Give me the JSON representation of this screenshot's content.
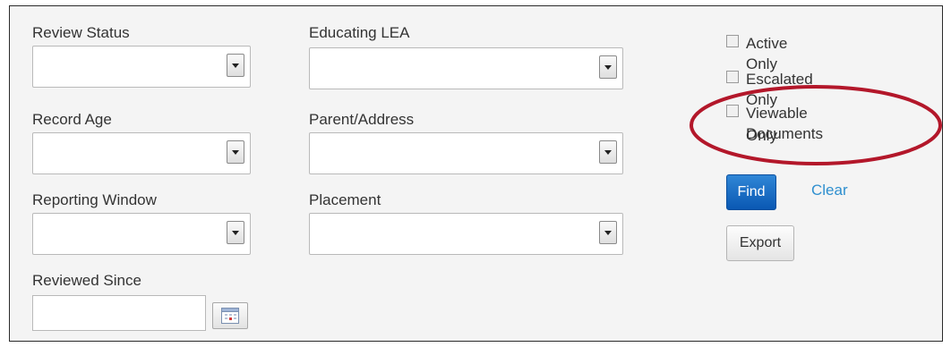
{
  "filters": {
    "review_status": {
      "label": "Review Status",
      "value": ""
    },
    "educating_lea": {
      "label": "Educating LEA",
      "value": ""
    },
    "record_age": {
      "label": "Record Age",
      "value": ""
    },
    "parent_address": {
      "label": "Parent/Address",
      "value": ""
    },
    "reporting_window": {
      "label": "Reporting Window",
      "value": ""
    },
    "placement": {
      "label": "Placement",
      "value": ""
    },
    "reviewed_since": {
      "label": "Reviewed Since",
      "value": ""
    }
  },
  "checkboxes": {
    "active_only": {
      "label": "Active Only",
      "checked": false
    },
    "escalated_only": {
      "label": "Escalated Only",
      "checked": false
    },
    "viewable_documents_only": {
      "label_line1": "Viewable Documents",
      "label_line2": "Only",
      "checked": false
    }
  },
  "buttons": {
    "find": "Find",
    "clear": "Clear",
    "export": "Export"
  },
  "colors": {
    "find_button": "#0a58b3",
    "clear_link": "#2f8fcf",
    "annotation_ellipse": "#b3172a",
    "panel_background": "#f4f4f4"
  },
  "icons": {
    "dropdown": "chevron-down-icon",
    "date_picker": "calendar-icon"
  }
}
